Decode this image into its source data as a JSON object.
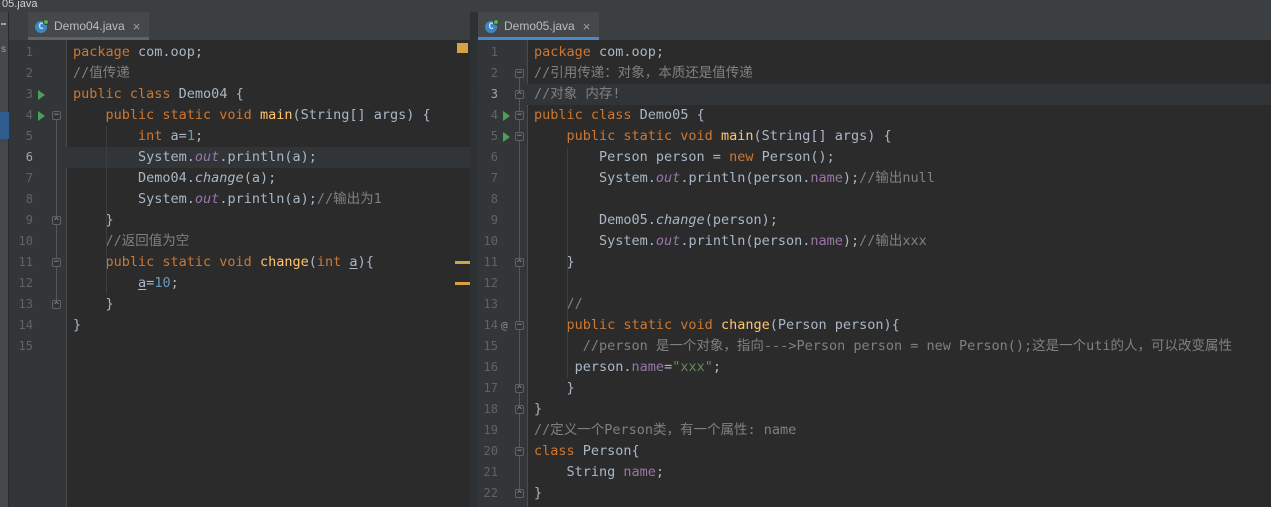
{
  "window": {
    "partial_tab_text": "05.java"
  },
  "project_panel": {
    "partial_text": "s"
  },
  "colors": {
    "editor_bg": "#2b2b2b",
    "gutter_bg": "#333639",
    "current_line_bg": "#323537",
    "tab_bar_bg": "#3c3f41",
    "active_tab_underline": "#4a88c7",
    "inactive_tab_underline": "#5e6366",
    "keyword": "#cc7832",
    "text": "#a9b7c6",
    "comment": "#808080",
    "number": "#6897bb",
    "string": "#6a8759",
    "method_decl": "#ffc66d",
    "field": "#9876aa",
    "line_number": "#606366",
    "run_arrow": "#4f9e58",
    "warning": "#d6a243",
    "selection_blue": "#2f5d8f"
  },
  "panes": [
    {
      "id": "demo04",
      "tab": {
        "title": "Demo04.java",
        "close_label": "×",
        "icon": "java-class-icon",
        "icon_letter": "C",
        "active": false
      },
      "current_line": 6,
      "run_arrow_lines": [
        3,
        4
      ],
      "fold_open_lines": [
        4,
        11
      ],
      "fold_end_lines": [
        9,
        13
      ],
      "gutter_badges": [],
      "warning_marks": {
        "top_square": true,
        "dash_lines": [
          11,
          12
        ]
      },
      "indent_guides": [
        {
          "col": 4,
          "from": 5,
          "to": 12
        }
      ],
      "lines": [
        [
          {
            "s": "kw",
            "t": "package"
          },
          {
            "s": "def",
            "t": " com.oop;"
          }
        ],
        [
          {
            "s": "cmt",
            "t": "//值传递"
          }
        ],
        [
          {
            "s": "kw",
            "t": "public class"
          },
          {
            "s": "def",
            "t": " Demo04 {"
          }
        ],
        [
          {
            "s": "def",
            "t": "    "
          },
          {
            "s": "kw",
            "t": "public static void"
          },
          {
            "s": "def",
            "t": " "
          },
          {
            "s": "mth",
            "t": "main"
          },
          {
            "s": "def",
            "t": "(String[] args) {"
          }
        ],
        [
          {
            "s": "def",
            "t": "        "
          },
          {
            "s": "kw",
            "t": "int"
          },
          {
            "s": "def",
            "t": " a="
          },
          {
            "s": "num",
            "t": "1"
          },
          {
            "s": "def",
            "t": ";"
          }
        ],
        [
          {
            "s": "def",
            "t": "        System."
          },
          {
            "s": "fldi",
            "t": "out"
          },
          {
            "s": "def",
            "t": ".println(a);"
          }
        ],
        [
          {
            "s": "def",
            "t": "        Demo04."
          },
          {
            "s": "mthi",
            "t": "change"
          },
          {
            "s": "def",
            "t": "(a);"
          }
        ],
        [
          {
            "s": "def",
            "t": "        System."
          },
          {
            "s": "fldi",
            "t": "out"
          },
          {
            "s": "def",
            "t": ".println(a);"
          },
          {
            "s": "cmt",
            "t": "//输出为1"
          }
        ],
        [
          {
            "s": "def",
            "t": "    }"
          }
        ],
        [
          {
            "s": "def",
            "t": "    "
          },
          {
            "s": "cmt",
            "t": "//返回值为空"
          }
        ],
        [
          {
            "s": "def",
            "t": "    "
          },
          {
            "s": "kw",
            "t": "public static void"
          },
          {
            "s": "def",
            "t": " "
          },
          {
            "s": "mth",
            "t": "change"
          },
          {
            "s": "def",
            "t": "("
          },
          {
            "s": "kw",
            "t": "int"
          },
          {
            "s": "def",
            "t": " "
          },
          {
            "s": "und",
            "t": "a"
          },
          {
            "s": "def",
            "t": "){"
          }
        ],
        [
          {
            "s": "def",
            "t": "        "
          },
          {
            "s": "und",
            "t": "a"
          },
          {
            "s": "def",
            "t": "="
          },
          {
            "s": "num",
            "t": "10"
          },
          {
            "s": "def",
            "t": ";"
          }
        ],
        [
          {
            "s": "def",
            "t": "    }"
          }
        ],
        [
          {
            "s": "def",
            "t": "}"
          }
        ],
        []
      ]
    },
    {
      "id": "demo05",
      "tab": {
        "title": "Demo05.java",
        "close_label": "×",
        "icon": "java-class-icon",
        "icon_letter": "C",
        "active": true
      },
      "current_line": 3,
      "run_arrow_lines": [
        4,
        5
      ],
      "fold_open_lines": [
        2,
        4,
        5,
        14,
        20
      ],
      "fold_end_lines": [
        3,
        11,
        17,
        18,
        22
      ],
      "gutter_badges": [
        {
          "line": 14,
          "text": "@"
        }
      ],
      "warning_marks": {
        "top_square": false,
        "dash_lines": []
      },
      "indent_guides": [
        {
          "col": 4,
          "from": 6,
          "to": 16
        }
      ],
      "lines": [
        [
          {
            "s": "kw",
            "t": "package"
          },
          {
            "s": "def",
            "t": " com.oop;"
          }
        ],
        [
          {
            "s": "cmt",
            "t": "//引用传递：对象，本质还是值传递"
          }
        ],
        [
          {
            "s": "cmt",
            "t": "//对象 内存!"
          }
        ],
        [
          {
            "s": "kw",
            "t": "public class"
          },
          {
            "s": "def",
            "t": " Demo05 {"
          }
        ],
        [
          {
            "s": "def",
            "t": "    "
          },
          {
            "s": "kw",
            "t": "public static void"
          },
          {
            "s": "def",
            "t": " "
          },
          {
            "s": "mth",
            "t": "main"
          },
          {
            "s": "def",
            "t": "(String[] args) {"
          }
        ],
        [
          {
            "s": "def",
            "t": "        Person person = "
          },
          {
            "s": "kw",
            "t": "new"
          },
          {
            "s": "def",
            "t": " Person();"
          }
        ],
        [
          {
            "s": "def",
            "t": "        System."
          },
          {
            "s": "fldi",
            "t": "out"
          },
          {
            "s": "def",
            "t": ".println(person."
          },
          {
            "s": "fld",
            "t": "name"
          },
          {
            "s": "def",
            "t": ");"
          },
          {
            "s": "cmt",
            "t": "//输出null"
          }
        ],
        [],
        [
          {
            "s": "def",
            "t": "        Demo05."
          },
          {
            "s": "mthi",
            "t": "change"
          },
          {
            "s": "def",
            "t": "(person);"
          }
        ],
        [
          {
            "s": "def",
            "t": "        System."
          },
          {
            "s": "fldi",
            "t": "out"
          },
          {
            "s": "def",
            "t": ".println(person."
          },
          {
            "s": "fld",
            "t": "name"
          },
          {
            "s": "def",
            "t": ");"
          },
          {
            "s": "cmt",
            "t": "//输出xxx"
          }
        ],
        [
          {
            "s": "def",
            "t": "    }"
          }
        ],
        [],
        [
          {
            "s": "def",
            "t": "    "
          },
          {
            "s": "cmt",
            "t": "//"
          }
        ],
        [
          {
            "s": "def",
            "t": "    "
          },
          {
            "s": "kw",
            "t": "public static void"
          },
          {
            "s": "def",
            "t": " "
          },
          {
            "s": "mth",
            "t": "change"
          },
          {
            "s": "def",
            "t": "(Person person){"
          }
        ],
        [
          {
            "s": "def",
            "t": "      "
          },
          {
            "s": "cmt",
            "t": "//person 是一个对象，指向--->Person person = new Person();这是一个uti的人，可以改变属性"
          }
        ],
        [
          {
            "s": "def",
            "t": "     person."
          },
          {
            "s": "fld",
            "t": "name"
          },
          {
            "s": "def",
            "t": "="
          },
          {
            "s": "str",
            "t": "\"xxx\""
          },
          {
            "s": "def",
            "t": ";"
          }
        ],
        [
          {
            "s": "def",
            "t": "    }"
          }
        ],
        [
          {
            "s": "def",
            "t": "}"
          }
        ],
        [
          {
            "s": "cmt",
            "t": "//定义一个Person类，有一个属性: name"
          }
        ],
        [
          {
            "s": "kw",
            "t": "class"
          },
          {
            "s": "def",
            "t": " Person{"
          }
        ],
        [
          {
            "s": "def",
            "t": "    String "
          },
          {
            "s": "fld",
            "t": "name"
          },
          {
            "s": "def",
            "t": ";"
          }
        ],
        [
          {
            "s": "def",
            "t": "}"
          }
        ]
      ]
    }
  ]
}
